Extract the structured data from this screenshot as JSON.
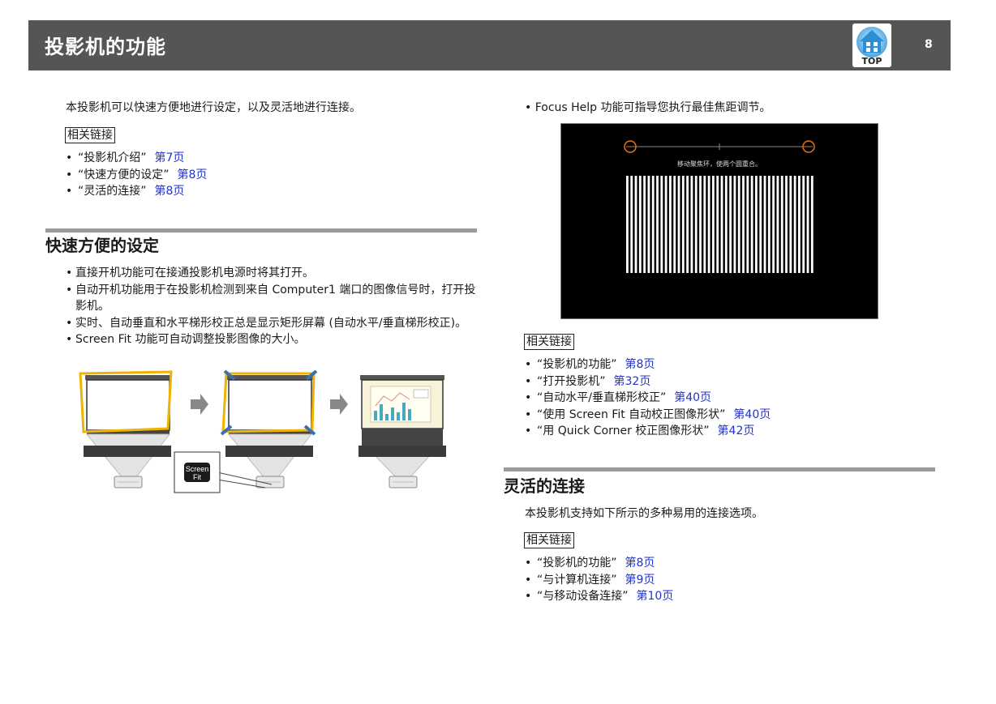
{
  "header": {
    "title": "投影机的功能",
    "top_label": "TOP",
    "page_number": "8"
  },
  "left": {
    "intro": "本投影机可以快速方便地进行设定，以及灵活地进行连接。",
    "related_label": "相关链接",
    "links": [
      {
        "text": "“投影机介绍”",
        "page": "第7页"
      },
      {
        "text": "“快速方便的设定”",
        "page": "第8页"
      },
      {
        "text": "“灵活的连接”",
        "page": "第8页"
      }
    ],
    "section_title": "快速方便的设定",
    "bullets": [
      "直接开机功能可在接通投影机电源时将其打开。",
      "自动开机功能用于在投影机检测到来自 Computer1 端口的图像信号时，打开投影机。",
      "实时、自动垂直和水平梯形校正总是显示矩形屏幕 (自动水平/垂直梯形校正)。",
      "Screen Fit 功能可自动调整投影图像的大小。"
    ],
    "screen_fit_badge": [
      "Screen",
      "Fit"
    ]
  },
  "right": {
    "focus_bullet": "Focus Help 功能可指导您执行最佳焦距调节。",
    "focus_image_caption": "移动聚焦环，使两个圆重合。",
    "related_label": "相关链接",
    "links": [
      {
        "text": "“投影机的功能”",
        "page": "第8页"
      },
      {
        "text": "“打开投影机”",
        "page": "第32页"
      },
      {
        "text": "“自动水平/垂直梯形校正”",
        "page": "第40页"
      },
      {
        "text": "“使用 Screen Fit 自动校正图像形状”",
        "page": "第40页"
      },
      {
        "text": "“用 Quick Corner 校正图像形状”",
        "page": "第42页"
      }
    ],
    "section_title": "灵活的连接",
    "intro": "本投影机支持如下所示的多种易用的连接选项。",
    "related_label2": "相关链接",
    "links2": [
      {
        "text": "“投影机的功能”",
        "page": "第8页"
      },
      {
        "text": "“与计算机连接”",
        "page": "第9页"
      },
      {
        "text": "“与移动设备连接”",
        "page": "第10页"
      }
    ]
  },
  "colors": {
    "header_bg": "#555555",
    "link": "#2233cc",
    "frame_yellow": "#f0b400",
    "arrow_blue": "#3a6fb0"
  }
}
